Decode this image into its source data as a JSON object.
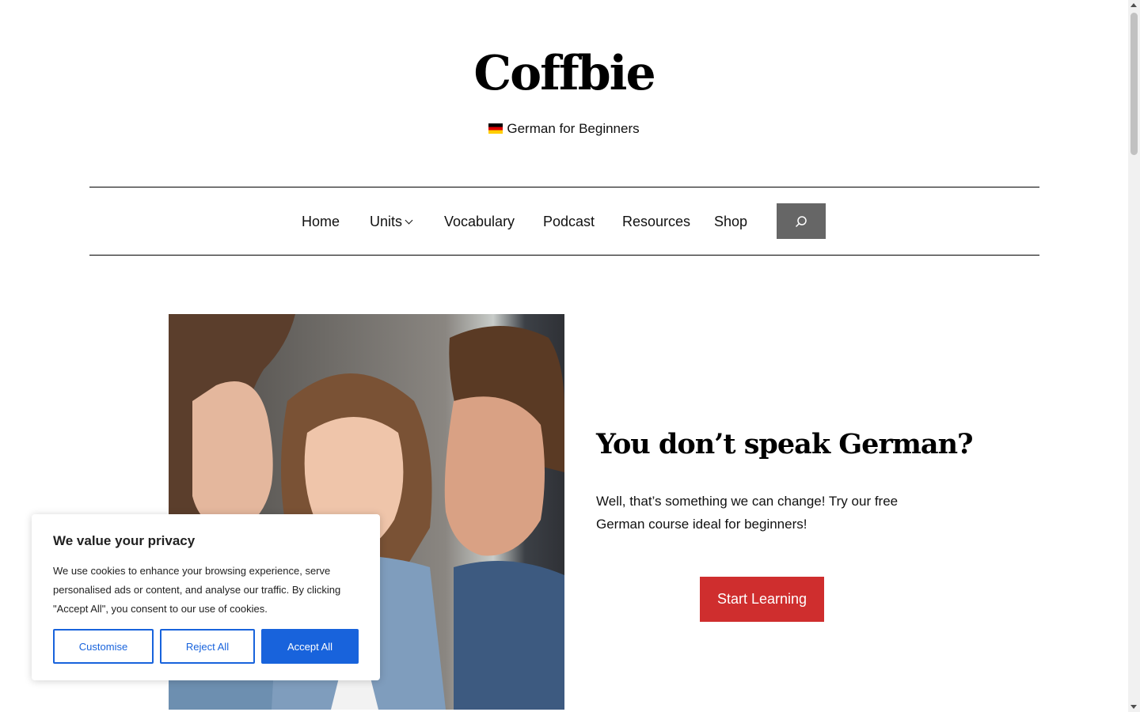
{
  "header": {
    "site_title": "Coffbie",
    "tagline": "German for Beginners"
  },
  "nav": {
    "items": [
      {
        "label": "Home"
      },
      {
        "label": "Units"
      },
      {
        "label": "Vocabulary"
      },
      {
        "label": "Podcast"
      },
      {
        "label": "Resources"
      },
      {
        "label": "Shop"
      }
    ],
    "search_icon": "search-icon"
  },
  "hero": {
    "heading": "You don’t speak German?",
    "text": "Well, that’s something we can change! Try our free German course ideal for beginners!",
    "cta_label": "Start Learning",
    "image_icon": "photo-three-people-smiling"
  },
  "cookie_banner": {
    "title": "We value your privacy",
    "body": "We use cookies to enhance your browsing experience, serve personalised ads or content, and analyse our traffic. By clicking \"Accept All\", you consent to our use of cookies.",
    "customise_label": "Customise",
    "reject_label": "Reject All",
    "accept_label": "Accept All"
  },
  "colors": {
    "cta": "#cf2e2e",
    "accept": "#1863dc",
    "search_button": "#666666"
  }
}
